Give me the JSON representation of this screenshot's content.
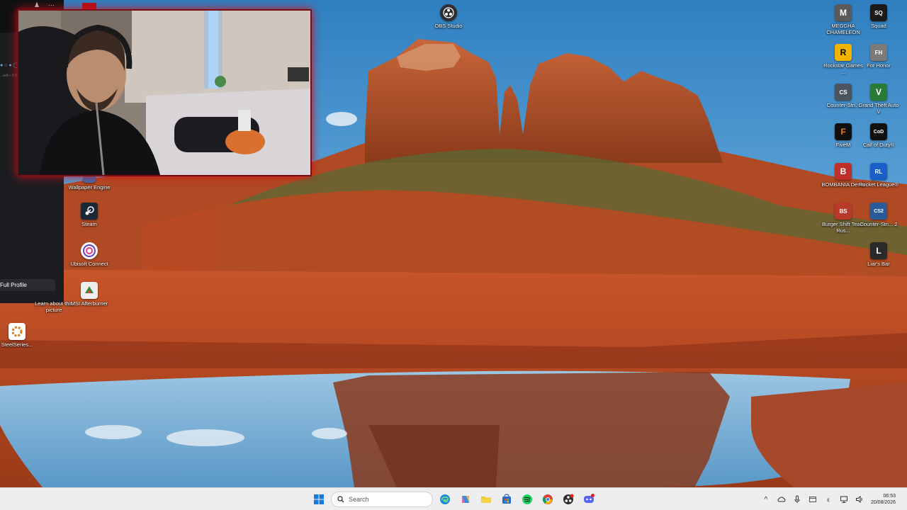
{
  "desktop": {
    "icons_left": [
      {
        "id": "wallpaper-engine",
        "label": "Wallpaper Engine",
        "glyph": "W",
        "color": "#3b6fb0"
      },
      {
        "id": "steam",
        "label": "Steam",
        "glyph": "S",
        "color": "#1b2838"
      },
      {
        "id": "ubisoft-connect",
        "label": "Ubisoft Connect",
        "glyph": "U",
        "color": "#6a3fc4"
      },
      {
        "id": "learn-about-picture",
        "label": "Learn about this picture",
        "glyph": "?",
        "color": "#3a80c8"
      },
      {
        "id": "msi-afterburner",
        "label": "MSI Afterburner",
        "glyph": "M",
        "color": "#2a8a3a"
      },
      {
        "id": "steelseries",
        "label": "SteelSeries...",
        "glyph": "S",
        "color": "#e07a1a"
      }
    ],
    "icons_top": [
      {
        "id": "obs-studio",
        "label": "OBS Studio",
        "glyph": "O",
        "color": "#302e31"
      }
    ],
    "icons_right": [
      {
        "id": "meggha-chameleon",
        "label": "MEGGHA CHAMELEON",
        "glyph": "M",
        "color": "#5a5a5a"
      },
      {
        "id": "squad",
        "label": "Squad",
        "glyph": "SQ",
        "color": "#1a1a1a"
      },
      {
        "id": "rockstar-games",
        "label": "Rockstar Games ...",
        "glyph": "R",
        "color": "#f0b400"
      },
      {
        "id": "for-honor",
        "label": "For Honor",
        "glyph": "FH",
        "color": "#7a7a7a"
      },
      {
        "id": "counter-strike-1",
        "label": "Counter-Stri...",
        "glyph": "CS",
        "color": "#4a5560"
      },
      {
        "id": "gta-v",
        "label": "Grand Theft Auto V",
        "glyph": "V",
        "color": "#2a7a3a"
      },
      {
        "id": "fivem",
        "label": "FiveM",
        "glyph": "F",
        "color": "#101010"
      },
      {
        "id": "call-of-duty",
        "label": "Call of Duty®",
        "glyph": "CoD",
        "color": "#111111"
      },
      {
        "id": "bombania-demo",
        "label": "BOMBANIA Demo",
        "glyph": "B",
        "color": "#c0302a"
      },
      {
        "id": "rocket-league",
        "label": "Rocket League®",
        "glyph": "RL",
        "color": "#1a5fc8"
      },
      {
        "id": "burger-shift",
        "label": "Burger Shift Team Rus...",
        "glyph": "BS",
        "color": "#b83a2a"
      },
      {
        "id": "counter-strike-2",
        "label": "Counter-Stri... 2",
        "glyph": "CS2",
        "color": "#2a5a9a"
      },
      {
        "id": "liars-bar",
        "label": "Liar's Bar",
        "glyph": "L",
        "color": "#2a2a2a"
      }
    ]
  },
  "left_panel": {
    "profile_button": "Full Profile",
    "status_line": "...",
    "sub_line": "...ads • 9 Ma"
  },
  "taskbar": {
    "search_placeholder": "Search",
    "pinned": [
      {
        "id": "start",
        "icon": "windows-icon"
      },
      {
        "id": "edge",
        "icon": "edge-icon"
      },
      {
        "id": "copilot",
        "icon": "copilot-icon"
      },
      {
        "id": "explorer",
        "icon": "folder-icon"
      },
      {
        "id": "store",
        "icon": "store-icon"
      },
      {
        "id": "spotify",
        "icon": "spotify-icon"
      },
      {
        "id": "chrome",
        "icon": "chrome-icon"
      },
      {
        "id": "obs",
        "icon": "obs-icon"
      },
      {
        "id": "discord",
        "icon": "discord-icon"
      }
    ],
    "tray": {
      "chevron": "^",
      "lang": "ε",
      "time": "06:53",
      "date": "20/08/2026"
    }
  },
  "colors": {
    "taskbar_bg": "#eeeef1",
    "webcam_glow": "#d0101a",
    "sky": "#5ea4d8",
    "rock": "#b54a24"
  }
}
